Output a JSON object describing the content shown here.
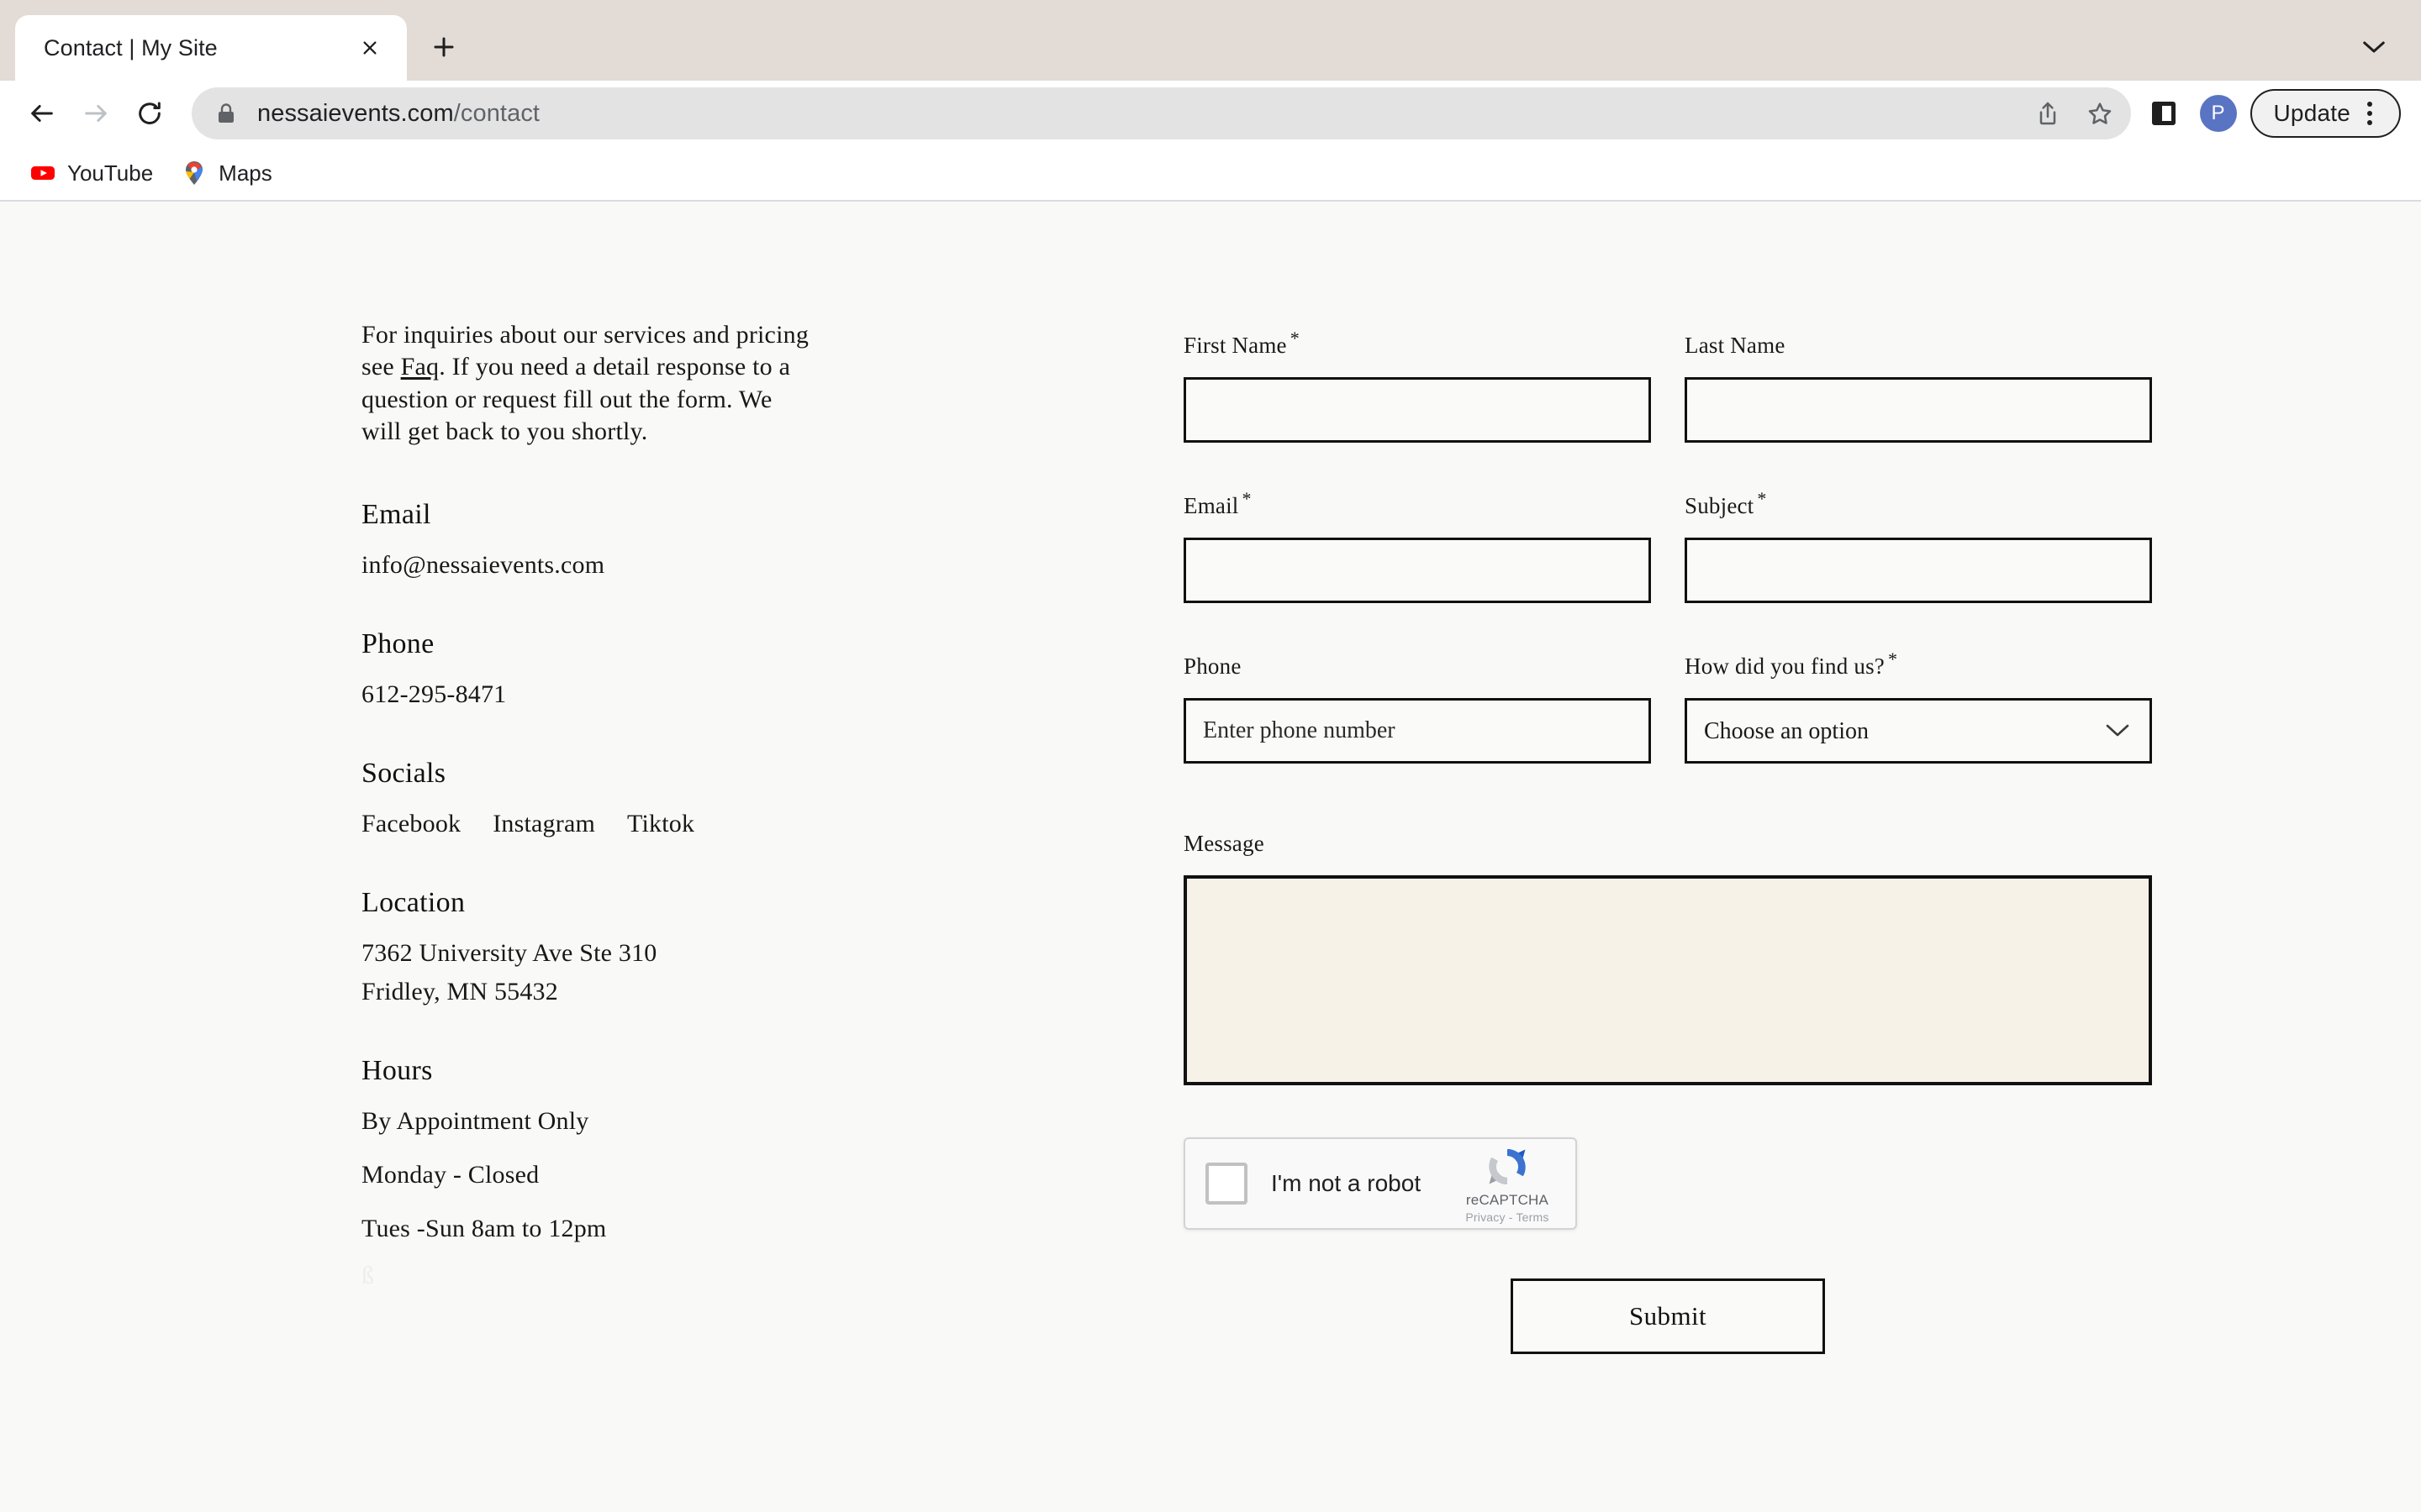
{
  "browser": {
    "tab": {
      "title": "Contact | My Site",
      "close_icon": "close-icon",
      "new_tab_icon": "plus-icon",
      "tab_list_icon": "chevron-down-icon"
    },
    "nav": {
      "back_icon": "arrow-back-icon",
      "forward_icon": "arrow-forward-icon",
      "reload_icon": "reload-icon"
    },
    "omnibox": {
      "lock_icon": "lock-icon",
      "url_host": "nessaievents.com",
      "url_path": "/contact",
      "share_icon": "share-icon",
      "bookmark_icon": "star-icon"
    },
    "actions": {
      "side_panel_icon": "side-panel-icon",
      "profile_initial": "P",
      "update_label": "Update",
      "menu_icon": "kebab-menu-icon"
    },
    "bookmarks": [
      {
        "label": "YouTube",
        "icon": "youtube-icon"
      },
      {
        "label": "Maps",
        "icon": "google-maps-pin-icon"
      }
    ]
  },
  "contact": {
    "intro": {
      "before_link": "For inquiries about our services and pricing see ",
      "link_text": "Faq",
      "after_link": ". If you need a detail response to a question or request fill out the form. We will get back to you shortly."
    },
    "email": {
      "heading": "Email",
      "value": "info@nessaievents.com"
    },
    "phone": {
      "heading": "Phone",
      "value": "612-295-8471"
    },
    "socials": {
      "heading": "Socials",
      "links": [
        "Facebook",
        "Instagram",
        "Tiktok"
      ]
    },
    "location": {
      "heading": "Location",
      "line1": "7362 University Ave Ste 310",
      "line2": "Fridley, MN 55432"
    },
    "hours": {
      "heading": "Hours",
      "lines": [
        "By Appointment Only",
        "Monday - Closed",
        "Tues -Sun 8am to 12pm"
      ],
      "trailing_char": "ß"
    }
  },
  "form": {
    "first_name": {
      "label": "First Name",
      "required": "*",
      "value": "",
      "placeholder": ""
    },
    "last_name": {
      "label": "Last Name",
      "required": "",
      "value": "",
      "placeholder": ""
    },
    "email": {
      "label": "Email",
      "required": "*",
      "value": "",
      "placeholder": ""
    },
    "subject": {
      "label": "Subject",
      "required": "*",
      "value": "",
      "placeholder": ""
    },
    "phone": {
      "label": "Phone",
      "required": "",
      "value": "",
      "placeholder": "Enter phone number"
    },
    "find_us": {
      "label": "How did you find us?",
      "required": "*",
      "selected": "Choose an option",
      "chevron_icon": "chevron-down-icon"
    },
    "message": {
      "label": "Message",
      "required": "",
      "value": "",
      "placeholder": ""
    },
    "recaptcha": {
      "checkbox_label": "I'm not a robot",
      "brand": "reCAPTCHA",
      "legal": "Privacy - Terms",
      "logo_icon": "recaptcha-logo-icon"
    },
    "submit_label": "Submit"
  },
  "colors": {
    "tabstrip": "#E2DBD6",
    "page_bg": "#F9F9F8",
    "field_border": "#111111",
    "textarea_bg": "#F7F2E8",
    "avatar_bg": "#5A74C4"
  }
}
